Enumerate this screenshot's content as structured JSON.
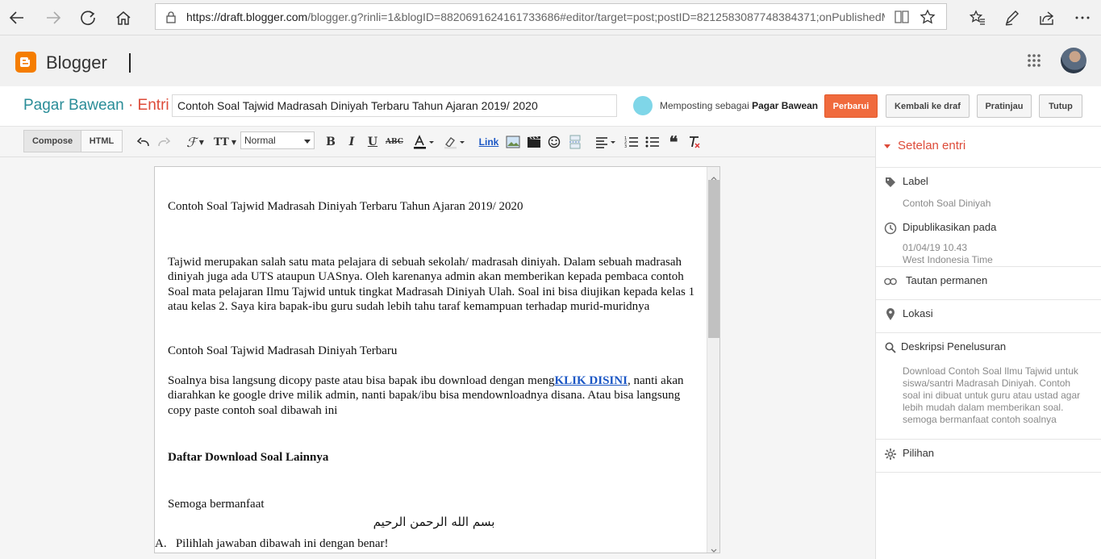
{
  "browser": {
    "url_host": "https://draft.blogger.com",
    "url_path": "/blogger.g?rinli=1&blogID=8820691624161733686#editor/target=post;postID=8212583087748384371;onPublishedMenu=all"
  },
  "app": {
    "brand": "Blogger",
    "accent_color": "#f57d00"
  },
  "post": {
    "blog_name": "Pagar Bawean",
    "separator": "·",
    "section": "Entri",
    "title": "Contoh Soal Tajwid Madrasah Diniyah Terbaru Tahun Ajaran 2019/ 2020",
    "posting_as_prefix": "Memposting sebagai",
    "posting_as_name": "Pagar Bawean",
    "buttons": {
      "update": "Perbarui",
      "back_to_draft": "Kembali ke draf",
      "preview": "Pratinjau",
      "close": "Tutup"
    }
  },
  "toolbar": {
    "compose": "Compose",
    "html": "HTML",
    "format": "Normal",
    "link": "Link"
  },
  "content": {
    "p1": "Contoh Soal Tajwid Madrasah Diniyah Terbaru Tahun Ajaran 2019/ 2020",
    "p2": "Tajwid merupakan salah satu mata pelajara di sebuah sekolah/ madrasah diniyah. Dalam sebuah madrasah diniyah juga ada UTS ataupun UASnya. Oleh karenanya admin akan memberikan kepada pembaca contoh Soal mata pelajaran Ilmu Tajwid untuk tingkat Madrasah Diniyah Ulah. Soal ini bisa diujikan kepada kelas 1 atau kelas 2. Saya kira bapak-ibu guru sudah lebih tahu taraf kemampuan terhadap murid-muridnya",
    "p3": "Contoh Soal Tajwid Madrasah Diniyah Terbaru",
    "p4_pre": "Soalnya bisa langsung dicopy paste atau bisa bapak ibu download dengan meng",
    "p4_link": "KLIK DISINI",
    "p4_post": ", nanti akan diarahkan ke google drive milik admin, nanti bapak/ibu bisa mendownloadnya disana. Atau bisa langsung copy paste contoh soal dibawah ini",
    "p5": "Daftar Download Soal Lainnya",
    "p6": "Semoga bermanfaat",
    "p7": "بسم الله الرحمن الرحيم",
    "list_marker": "A.",
    "p8": "Pilihlah jawaban dibawah ini dengan benar!"
  },
  "sidebar": {
    "header": "Setelan entri",
    "label": {
      "title": "Label",
      "value": "Contoh Soal Diniyah"
    },
    "published": {
      "title": "Dipublikasikan pada",
      "date": "01/04/19 10.43",
      "timezone": "West Indonesia Time"
    },
    "permalink": {
      "title": "Tautan permanen"
    },
    "location": {
      "title": "Lokasi"
    },
    "search_desc": {
      "title": "Deskripsi Penelusuran",
      "value": "Download Contoh Soal Ilmu Tajwid untuk siswa/santri Madrasah Diniyah. Contoh soal ini dibuat untuk guru atau ustad agar lebih mudah dalam memberikan soal. semoga bermanfaat contoh soalnya"
    },
    "options": {
      "title": "Pilihan"
    }
  }
}
